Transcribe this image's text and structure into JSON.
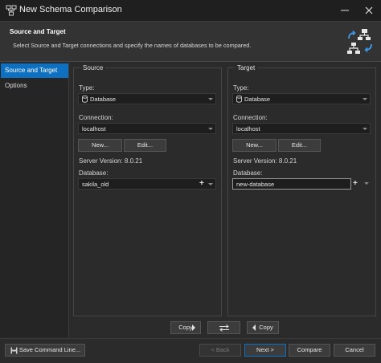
{
  "window": {
    "title": "New Schema Comparison",
    "icon": "schema-compare-icon",
    "controls": {
      "close_icon": "close-icon"
    }
  },
  "header": {
    "title": "Source and Target",
    "description": "Select Source and Target connections and specify the names of databases to be compared.",
    "icon": "schema-compare-swap-icon"
  },
  "nav": {
    "items": [
      {
        "label": "Source and Target",
        "active": true
      },
      {
        "label": "Options",
        "active": false
      }
    ]
  },
  "source": {
    "group_title": "Source",
    "type_label": "Type:",
    "type_value": "Database",
    "connection_label": "Connection:",
    "connection_value": "localhost",
    "new_button": "New...",
    "edit_button": "Edit...",
    "server_version": "Server Version: 8.0.21",
    "database_label": "Database:",
    "database_value": "sakila_old"
  },
  "target": {
    "group_title": "Target",
    "type_label": "Type:",
    "type_value": "Database",
    "connection_label": "Connection:",
    "connection_value": "localhost",
    "new_button": "New...",
    "edit_button": "Edit...",
    "server_version": "Server Version: 8.0.21",
    "database_label": "Database:",
    "database_value": "new-database"
  },
  "copy_bar": {
    "copy_right_label": "Copy",
    "swap_icon": "swap-icon",
    "copy_left_label": "Copy"
  },
  "footer": {
    "save_command_line": "Save Command Line...",
    "back": "< Back",
    "next": "Next >",
    "compare": "Compare",
    "cancel": "Cancel"
  },
  "colors": {
    "accent": "#0e70c0",
    "background": "#2b2b2b",
    "field": "#1e1e1e"
  }
}
